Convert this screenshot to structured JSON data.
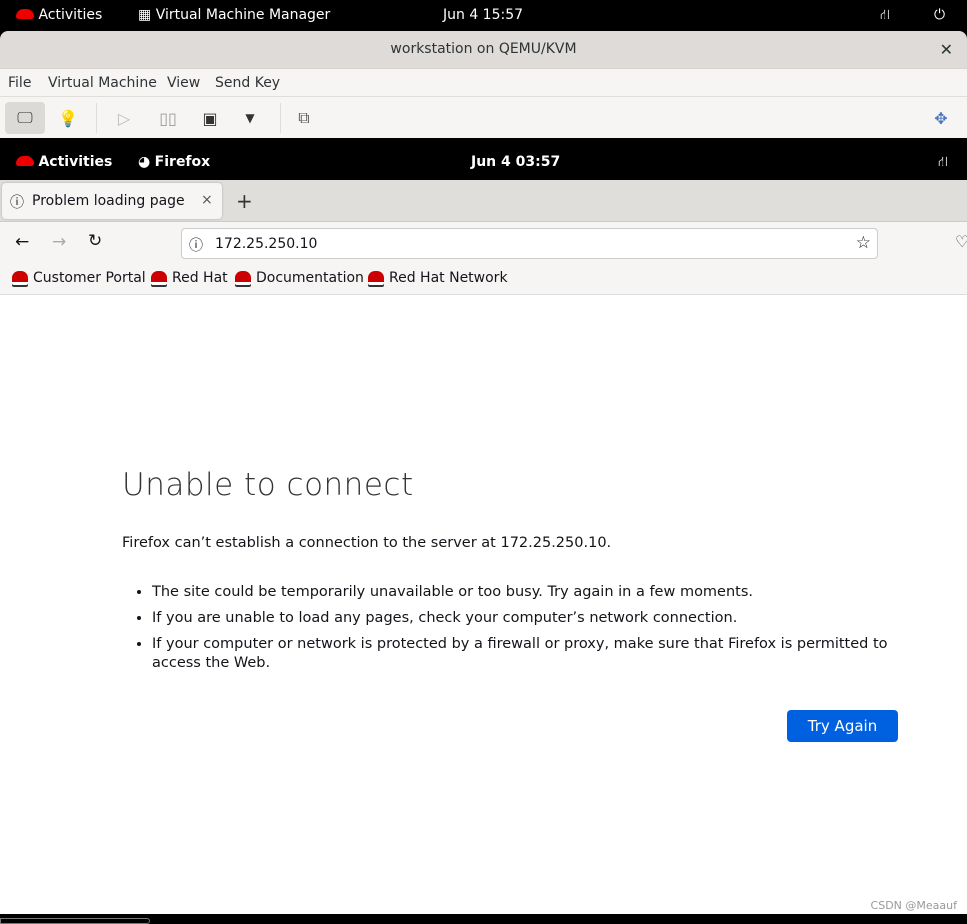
{
  "host_topbar": {
    "activities": "Activities",
    "app": "Virtual Machine Manager",
    "clock": "Jun 4  15:57"
  },
  "window": {
    "title": "workstation on QEMU/KVM",
    "menu": [
      "File",
      "Virtual Machine",
      "View",
      "Send Key"
    ]
  },
  "guest_topbar": {
    "activities": "Activities",
    "app": "Firefox",
    "clock": "Jun 4  03:57"
  },
  "browser": {
    "tab_title": "Problem loading page",
    "url": "172.25.250.10",
    "bookmarks": [
      "Customer Portal",
      "Red Hat",
      "Documentation",
      "Red Hat Network"
    ]
  },
  "page": {
    "heading": "Unable to connect",
    "intro": "Firefox can’t establish a connection to the server at 172.25.250.10.",
    "bullets": [
      "The site could be temporarily unavailable or too busy. Try again in a few moments.",
      "If you are unable to load any pages, check your computer’s network connection.",
      "If your computer or network is protected by a firewall or proxy, make sure that Firefox is permitted to access the Web."
    ],
    "button": "Try Again"
  },
  "watermark": "CSDN @Meaauf",
  "colors": {
    "accent": "#0061e0",
    "redhat": "#ee0000"
  }
}
